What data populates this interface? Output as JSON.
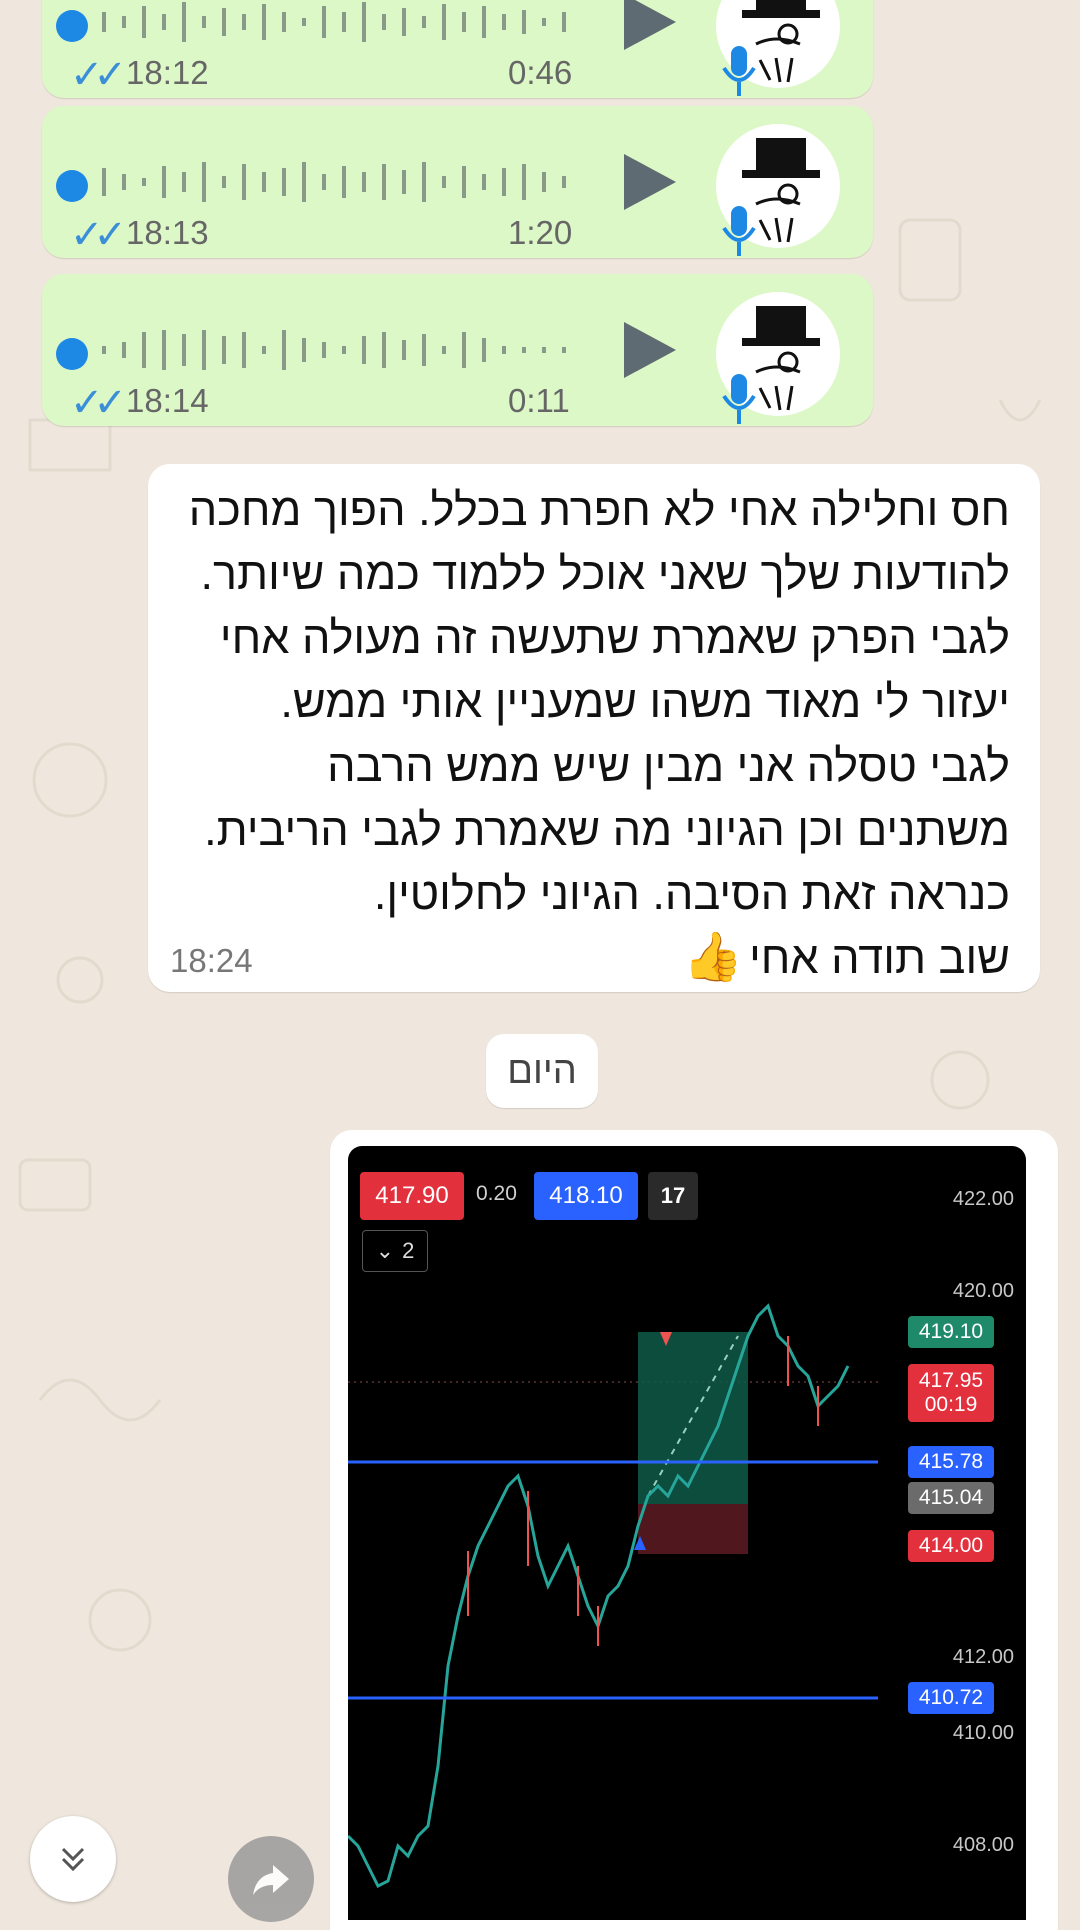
{
  "voice_messages": [
    {
      "time": "18:12",
      "duration": "0:46"
    },
    {
      "time": "18:13",
      "duration": "1:20"
    },
    {
      "time": "18:14",
      "duration": "0:11"
    }
  ],
  "text_message": {
    "lines": [
      "חס וחלילה אחי לא חפרת בכלל. הפוך מחכה",
      "להודעות שלך שאני אוכל ללמוד כמה שיותר.",
      "לגבי הפרק שאמרת שתעשה זה מעולה אחי",
      "יעזור לי מאוד משהו שמעניין אותי ממש.",
      "לגבי טסלה אני מבין שיש ממש הרבה",
      "משתנים וכן הגיוני מה שאמרת לגבי הריבית.",
      "כנראה זאת הסיבה. הגיוני לחלוטין.",
      "שוב תודה אחי"
    ],
    "emoji": "👍",
    "time": "18:24"
  },
  "date_chip": "היום",
  "chart": {
    "bid": "417.90",
    "spread": "0.20",
    "ask": "418.10",
    "logo": "17",
    "interval_count": "2",
    "price_axis": [
      "422.00",
      "420.00",
      "412.00",
      "410.00",
      "408.00"
    ],
    "tags": {
      "target": "419.10",
      "last_price": "417.95",
      "countdown": "00:19",
      "upper_line": "415.78",
      "entry": "415.04",
      "stop": "414.00",
      "lower_line": "410.72"
    },
    "colors": {
      "up": "#26a69a",
      "down": "#ef5350",
      "line": "#2962ff"
    }
  },
  "icons": {
    "read_receipt": "double-check-icon",
    "play": "play-icon",
    "mic": "mic-icon",
    "scroll_down": "chevron-double-down-icon",
    "share": "share-forward-icon"
  }
}
